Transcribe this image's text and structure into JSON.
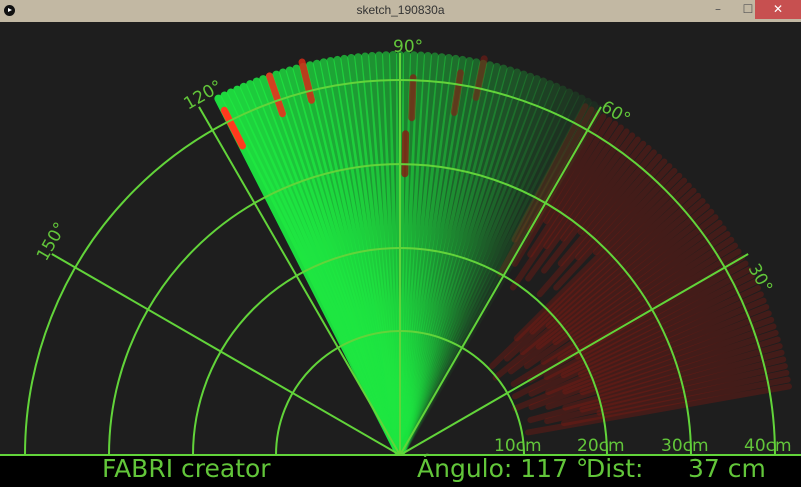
{
  "window": {
    "title": "sketch_190830a",
    "minimize": "–",
    "maximize": "☐",
    "close": "✕"
  },
  "radar": {
    "angle_labels": [
      "30°",
      "60°",
      "90°",
      "120°",
      "150°"
    ],
    "distance_labels": [
      "10cm",
      "20cm",
      "30cm",
      "40cm"
    ],
    "current_angle": 117,
    "current_distance_cm": 37,
    "colors": {
      "grid": "#62d43a",
      "sweep": "#1ee641",
      "object": "#e8321e",
      "text": "#62c63a"
    }
  },
  "footer": {
    "creator": "FABRI creator",
    "angle_text": "Ángulo: 117 °",
    "distance_label": "Dist:",
    "distance_value": "37 cm"
  }
}
